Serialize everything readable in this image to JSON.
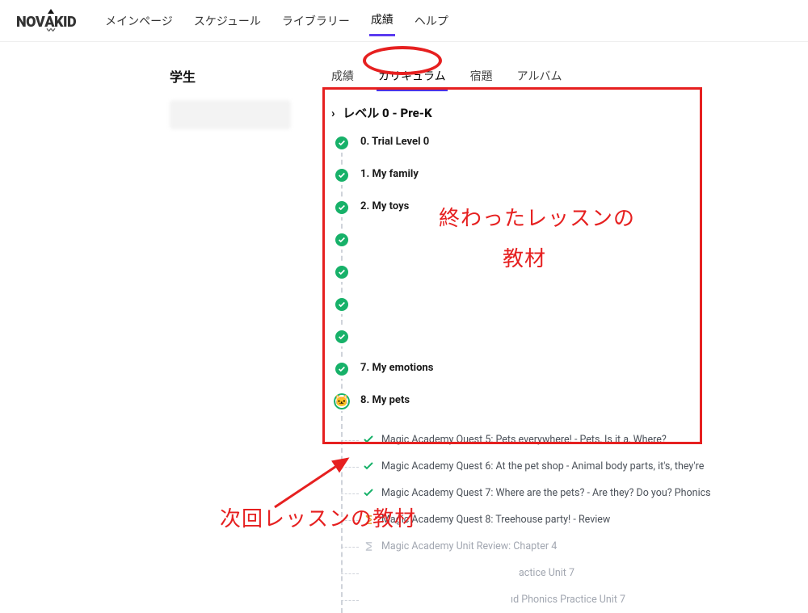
{
  "brand": "NOVAKID",
  "nav": {
    "items": [
      "メインページ",
      "スケジュール",
      "ライブラリー",
      "成績",
      "ヘルプ"
    ],
    "active_index": 3
  },
  "sidebar": {
    "title": "学生"
  },
  "tabs": {
    "items": [
      "成績",
      "カリキュラム",
      "宿題",
      "アルバム"
    ],
    "active_index": 1
  },
  "level_title": "レベル 0 - Pre-K",
  "units": [
    {
      "label": "0. Trial Level 0",
      "status": "done"
    },
    {
      "label": "1. My family",
      "status": "done"
    },
    {
      "label": "2. My toys",
      "status": "done"
    },
    {
      "label": "",
      "status": "done"
    },
    {
      "label": "",
      "status": "done"
    },
    {
      "label": "",
      "status": "done"
    },
    {
      "label": "",
      "status": "done"
    },
    {
      "label": "7. My emotions",
      "status": "done"
    },
    {
      "label": "8. My pets",
      "status": "current"
    }
  ],
  "sublessons": [
    {
      "label": "Magic Academy Quest 5: Pets everywhere! - Pets, Is it a, Where?",
      "status": "check"
    },
    {
      "label": "Magic Academy Quest 6: At the pet shop - Animal body parts, it's, they're",
      "status": "check"
    },
    {
      "label": "Magic Academy Quest 7: Where are the pets? - Are they? Do you? Phonics",
      "status": "check"
    },
    {
      "label": "Magic Academy Quest 8: Treehouse party! - Review",
      "status": "pending"
    },
    {
      "label": "Magic Academy Unit Review: Chapter 4",
      "status": "future"
    },
    {
      "label": "actice Unit 7",
      "status": "future",
      "clipped": true
    },
    {
      "label": "ıd Phonics Practice Unit 7",
      "status": "future",
      "clipped": true
    }
  ],
  "annotations": {
    "done_label_1": "終わったレッスンの",
    "done_label_2": "教材",
    "next_label": "次回レッスンの教材"
  }
}
